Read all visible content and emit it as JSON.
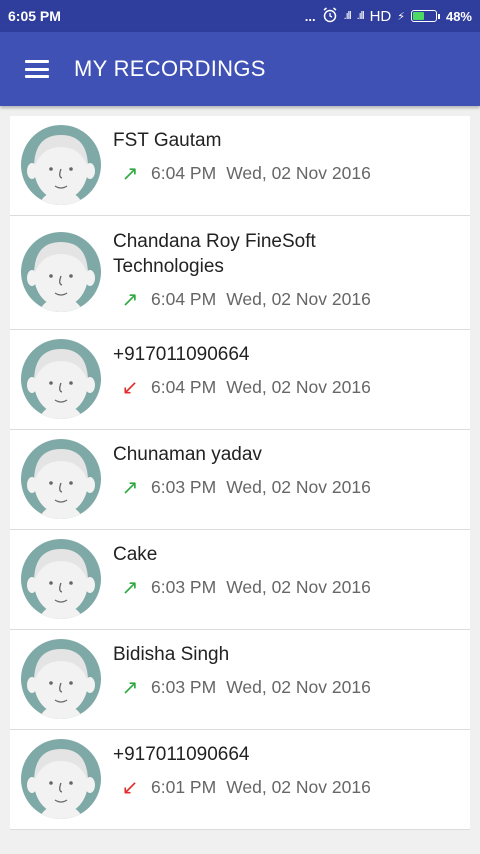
{
  "status_bar": {
    "time": "6:05 PM",
    "dots": "...",
    "alarm_icon": "alarm-clock-icon",
    "signal1": ".ıll",
    "signal2": ".ıll",
    "network": "HD",
    "charging_icon": "⚡",
    "battery": "48%"
  },
  "app_bar": {
    "title": "MY RECORDINGS",
    "menu_icon": "hamburger-menu-icon"
  },
  "recordings": [
    {
      "name": "FST Gautam",
      "direction": "outgoing",
      "arrow": "↗",
      "time": "6:04 PM",
      "date": "Wed, 02 Nov 2016"
    },
    {
      "name": "Chandana Roy FineSoft Technologies",
      "direction": "outgoing",
      "arrow": "↗",
      "time": "6:04 PM",
      "date": "Wed, 02 Nov 2016"
    },
    {
      "name": "+917011090664",
      "direction": "incoming",
      "arrow": "↙",
      "time": "6:04 PM",
      "date": "Wed, 02 Nov 2016"
    },
    {
      "name": "Chunaman yadav",
      "direction": "outgoing",
      "arrow": "↗",
      "time": "6:03 PM",
      "date": "Wed, 02 Nov 2016"
    },
    {
      "name": "Cake",
      "direction": "outgoing",
      "arrow": "↗",
      "time": "6:03 PM",
      "date": "Wed, 02 Nov 2016"
    },
    {
      "name": "Bidisha Singh",
      "direction": "outgoing",
      "arrow": "↗",
      "time": "6:03 PM",
      "date": "Wed, 02 Nov 2016"
    },
    {
      "name": "+917011090664",
      "direction": "incoming",
      "arrow": "↙",
      "time": "6:01 PM",
      "date": "Wed, 02 Nov 2016"
    }
  ],
  "colors": {
    "status_bar": "#2f3d9c",
    "app_bar": "#3f51b5",
    "outgoing_arrow": "#2eab3f",
    "incoming_arrow": "#e0302e",
    "avatar_bg": "#7fa9a6"
  }
}
